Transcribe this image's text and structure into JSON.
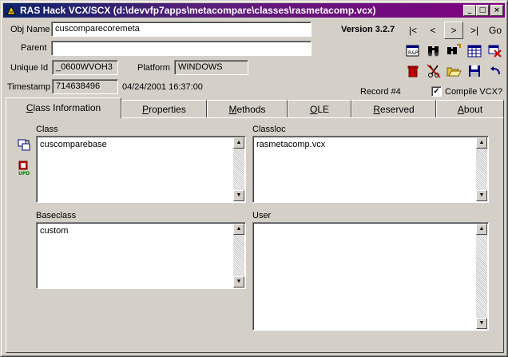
{
  "window": {
    "title": "RAS Hack VCX/SCX (d:\\devvfp7apps\\metacompare\\classes\\rasmetacomp.vcx)",
    "controls": [
      "_",
      "□",
      "×"
    ]
  },
  "form": {
    "obj_name_label": "Obj Name",
    "obj_name_value": "cuscomparecoremeta",
    "parent_label": "Parent",
    "parent_value": "",
    "unique_id_label": "Unique Id",
    "unique_id_value": "_0600WVOH3",
    "platform_label": "Platform",
    "platform_value": "WINDOWS",
    "timestamp_label": "Timestamp",
    "timestamp_value": "714638496",
    "timestamp_date": "04/24/2001 16:37:00",
    "version": "Version 3.2.7",
    "record": "Record #4",
    "compile_label": "Compile VCX?",
    "compile_checked": true
  },
  "nav": {
    "first": "|<",
    "prev": "<",
    "next": ">",
    "last": ">|",
    "go": "Go"
  },
  "toolbar_icons": [
    "report-icon",
    "binoculars-icon",
    "find-next-icon",
    "grid-icon",
    "delete-table-icon",
    "trash-icon",
    "cut-scissors-icon",
    "open-folder-icon",
    "save-disk-icon",
    "undo-icon"
  ],
  "tabs": {
    "items": [
      {
        "label": "Class Information",
        "u": "C"
      },
      {
        "label": "Properties",
        "u": "P"
      },
      {
        "label": "Methods",
        "u": "M"
      },
      {
        "label": "OLE",
        "u": "O"
      },
      {
        "label": "Reserved",
        "u": "R"
      },
      {
        "label": "About",
        "u": "A"
      }
    ],
    "active": 0
  },
  "panel": {
    "class_label": "Class",
    "class_value": "cuscomparebase",
    "classloc_label": "Classloc",
    "classloc_value": "rasmetacomp.vcx",
    "baseclass_label": "Baseclass",
    "baseclass_value": "custom",
    "user_label": "User",
    "user_value": "",
    "side_icons": [
      "copy-class-icon",
      "update-class-icon"
    ]
  }
}
